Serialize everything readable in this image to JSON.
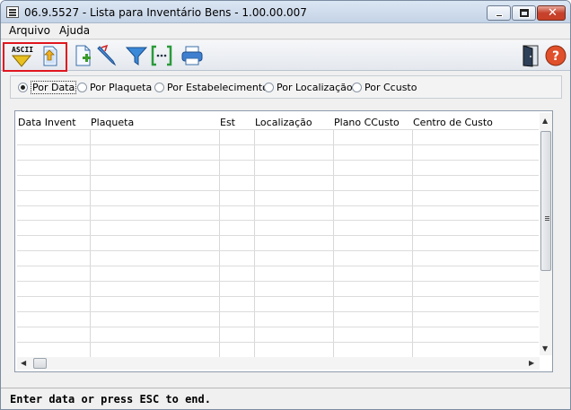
{
  "window": {
    "title": "06.9.5527 - Lista para Inventário Bens - 1.00.00.007"
  },
  "menu": {
    "items": [
      "Arquivo",
      "Ajuda"
    ]
  },
  "toolbar": {
    "ascii_label": "ASCII",
    "buttons": [
      "ascii-export-icon",
      "import-icon",
      "new-document-icon",
      "edit-icon",
      "filter-icon",
      "select-range-icon",
      "print-icon",
      "exit-door-icon",
      "help-icon"
    ]
  },
  "sort_options": {
    "selected": "Por Data",
    "items": [
      "Por Data",
      "Por Plaqueta",
      "Por Estabelecimento",
      "Por Localização",
      "Por Ccusto"
    ]
  },
  "grid": {
    "columns": [
      "Data Invent",
      "Plaqueta",
      "Est",
      "Localização",
      "Plano CCusto",
      "Centro de Custo"
    ]
  },
  "status": {
    "text": "Enter data or press ESC to end."
  }
}
